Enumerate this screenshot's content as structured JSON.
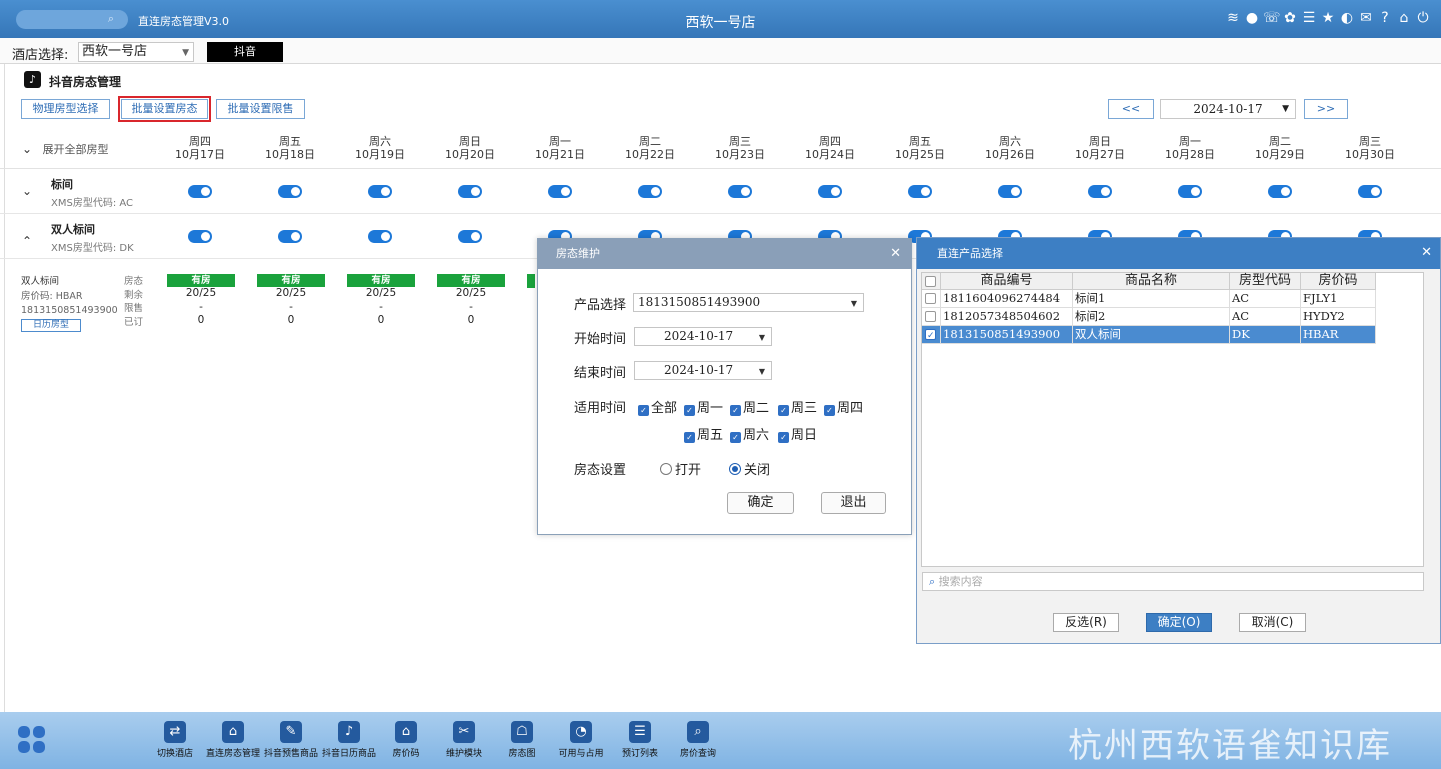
{
  "titlebar": {
    "search_icon": "search-icon",
    "app_name": "直连房态管理V3.0",
    "window_title": "西软一号店",
    "icons": [
      "wifi-icon",
      "comment-icon",
      "phone-icon",
      "palette-icon",
      "menu-icon",
      "star-icon",
      "contrast-icon",
      "mail-icon",
      "help-icon",
      "home-icon",
      "power-icon"
    ]
  },
  "hotel": {
    "label": "酒店选择:",
    "value": "西软一号店",
    "channel_button": "抖音"
  },
  "page": {
    "title": "抖音房态管理",
    "tiktok_glyph": "♪"
  },
  "toolbar": {
    "physical_room_type": "物理房型选择",
    "batch_status": "批量设置房态",
    "batch_limit": "批量设置限售",
    "prev": "<<",
    "next": ">>",
    "date": "2024-10-17"
  },
  "grid": {
    "expand_all": "展开全部房型",
    "days": [
      {
        "w": "周四",
        "d": "10月17日"
      },
      {
        "w": "周五",
        "d": "10月18日"
      },
      {
        "w": "周六",
        "d": "10月19日"
      },
      {
        "w": "周日",
        "d": "10月20日"
      },
      {
        "w": "周一",
        "d": "10月21日"
      },
      {
        "w": "周二",
        "d": "10月22日"
      },
      {
        "w": "周三",
        "d": "10月23日"
      },
      {
        "w": "周四",
        "d": "10月24日"
      },
      {
        "w": "周五",
        "d": "10月25日"
      },
      {
        "w": "周六",
        "d": "10月26日"
      },
      {
        "w": "周日",
        "d": "10月27日"
      },
      {
        "w": "周一",
        "d": "10月28日"
      },
      {
        "w": "周二",
        "d": "10月29日"
      },
      {
        "w": "周三",
        "d": "10月30日"
      }
    ],
    "rooms": [
      {
        "name": "标间",
        "code": "XMS房型代码: AC"
      },
      {
        "name": "双人标间",
        "code": "XMS房型代码: DK"
      }
    ],
    "detail": {
      "name": "双人标间",
      "price_code": "房价码: HBAR",
      "product_id": "1813150851493900",
      "calendar_button": "日历房型",
      "labels": [
        "房态",
        "剩余",
        "限售",
        "已订"
      ],
      "cells": [
        {
          "status": "有房",
          "remain": "20/25",
          "limit": "-",
          "booked": "0"
        },
        {
          "status": "有房",
          "remain": "20/25",
          "limit": "-",
          "booked": "0"
        },
        {
          "status": "有房",
          "remain": "20/25",
          "limit": "-",
          "booked": "0"
        },
        {
          "status": "有房",
          "remain": "20/25",
          "limit": "-",
          "booked": "0"
        }
      ]
    }
  },
  "dialog1": {
    "title": "房态维护",
    "product_label": "产品选择",
    "product_value": "1813150851493900",
    "start_label": "开始时间",
    "start_value": "2024-10-17",
    "end_label": "结束时间",
    "end_value": "2024-10-17",
    "apply_label": "适用时间",
    "days": [
      "全部",
      "周一",
      "周二",
      "周三",
      "周四",
      "周五",
      "周六",
      "周日"
    ],
    "status_label": "房态设置",
    "open": "打开",
    "close": "关闭",
    "ok": "确定",
    "exit": "退出"
  },
  "dialog2": {
    "title": "直连产品选择",
    "columns": [
      "商品编号",
      "商品名称",
      "房型代码",
      "房价码"
    ],
    "rows": [
      {
        "id": "1811604096274484",
        "name": "标间1",
        "room": "AC",
        "price": "FJLY1",
        "checked": false
      },
      {
        "id": "1812057348504602",
        "name": "标间2",
        "room": "AC",
        "price": "HYDY2",
        "checked": false
      },
      {
        "id": "1813150851493900",
        "name": "双人标间",
        "room": "DK",
        "price": "HBAR",
        "checked": true
      }
    ],
    "search_placeholder": "搜索内容",
    "invert": "反选(R)",
    "ok": "确定(O)",
    "cancel": "取消(C)"
  },
  "footer": {
    "items": [
      {
        "label": "切换酒店",
        "icon": "swap-icon"
      },
      {
        "label": "直连房态管理",
        "icon": "home-gear-icon"
      },
      {
        "label": "抖音预售商品",
        "icon": "edit-icon"
      },
      {
        "label": "抖音日历商品",
        "icon": "tiktok-icon"
      },
      {
        "label": "房价码",
        "icon": "house-icon"
      },
      {
        "label": "维护模块",
        "icon": "wrench-icon"
      },
      {
        "label": "房态图",
        "icon": "bank-icon"
      },
      {
        "label": "可用与占用",
        "icon": "pie-icon"
      },
      {
        "label": "预订列表",
        "icon": "list-icon"
      },
      {
        "label": "房价查询",
        "icon": "search-doc-icon"
      }
    ],
    "watermark": "杭州西软语雀知识库"
  },
  "colors": {
    "titlebar": "#3576b8",
    "accent": "#1d78d8",
    "status_green": "#1aa23c",
    "highlight": "#d9262c"
  }
}
